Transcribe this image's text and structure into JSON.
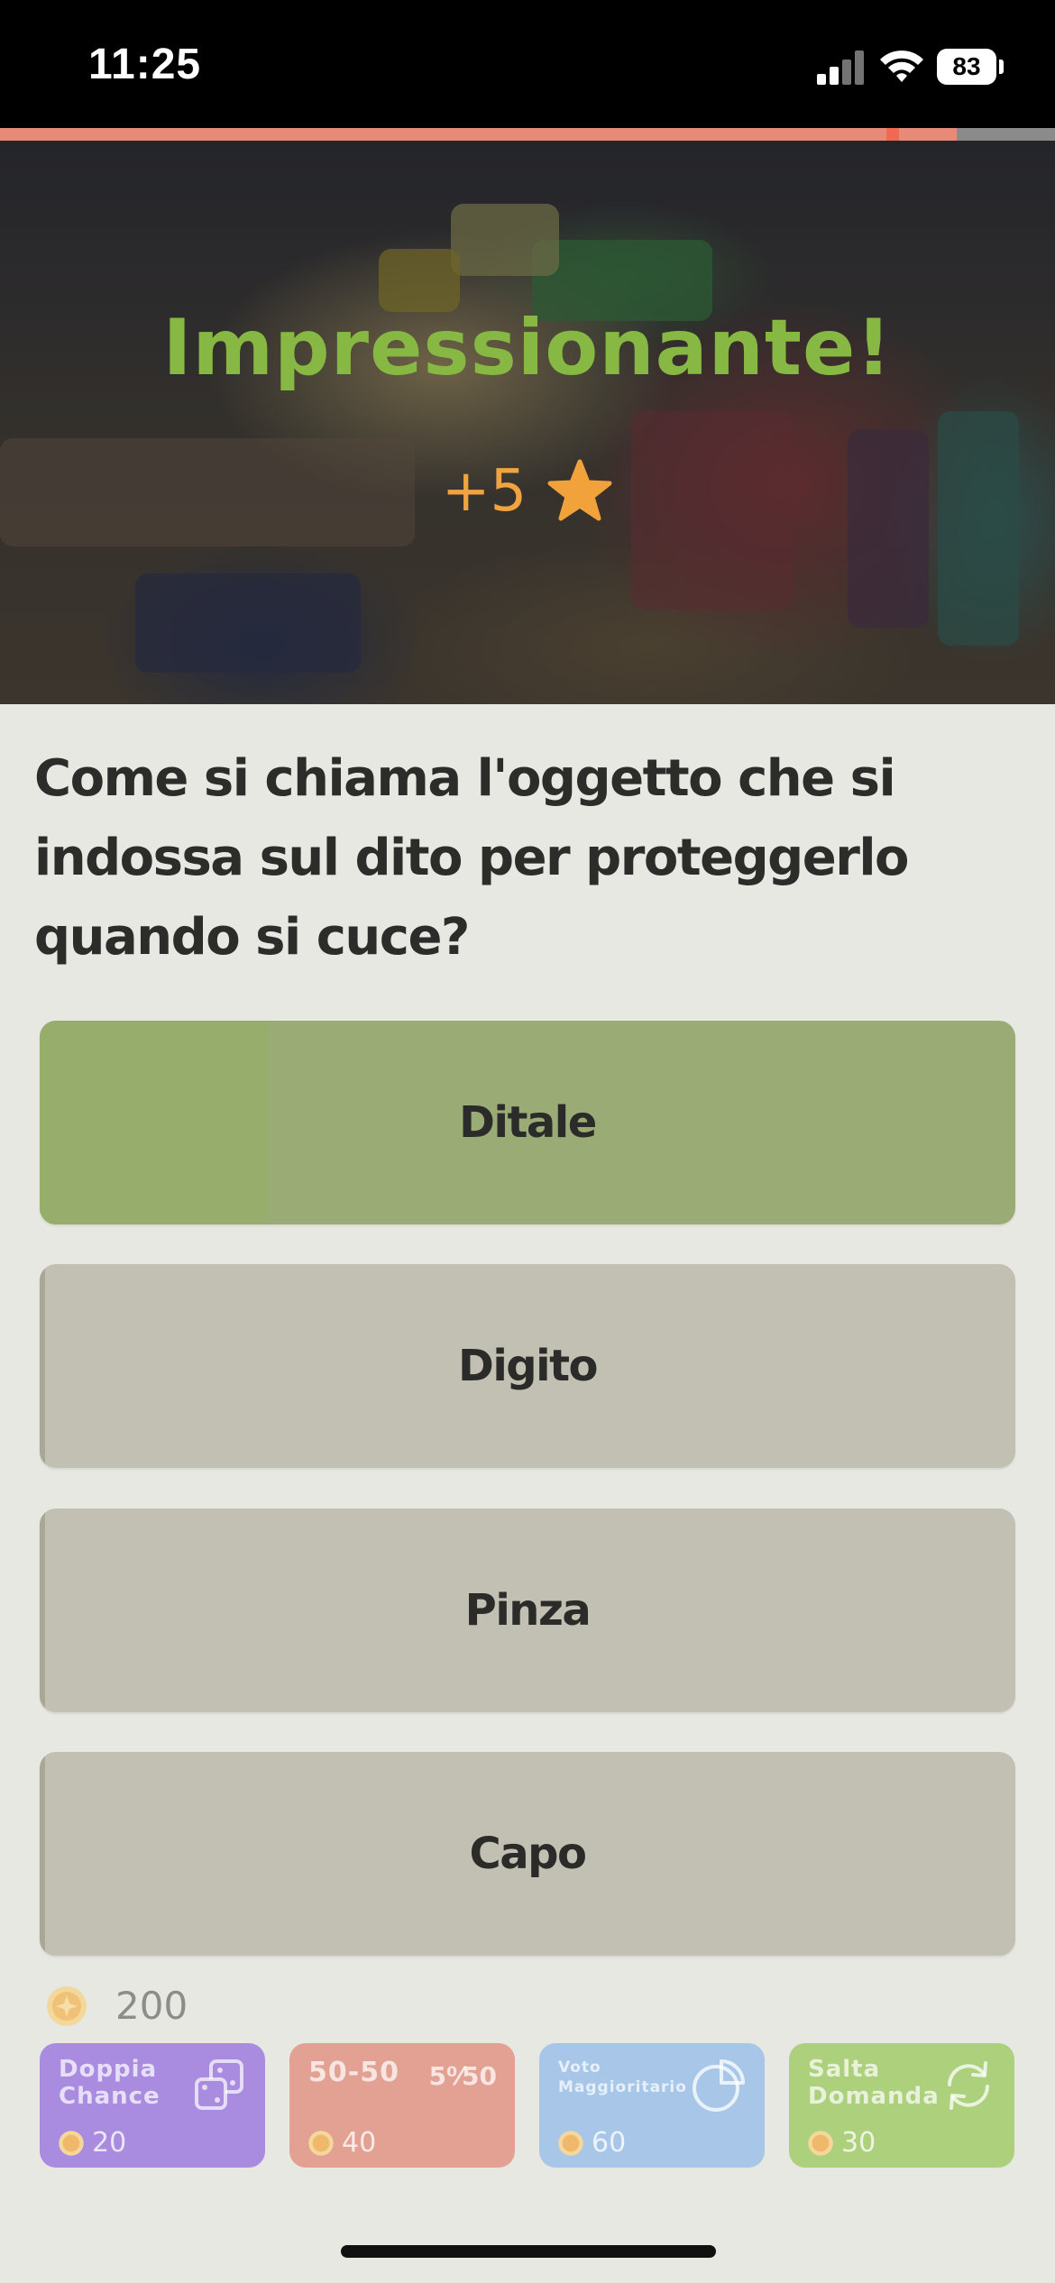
{
  "status_bar": {
    "time": "11:25",
    "battery": "83"
  },
  "progress": {
    "fraction": 0.907,
    "marker_fraction": 0.84
  },
  "hero": {
    "title": "Impressionante!",
    "points": "+5",
    "icon": "star-icon"
  },
  "question": {
    "text": "Come si chiama l'oggetto che si indossa sul dito per proteggerlo quando si cuce?"
  },
  "answers": [
    {
      "label": "Ditale",
      "state": "correct"
    },
    {
      "label": "Digito",
      "state": "disabled"
    },
    {
      "label": "Pinza",
      "state": "disabled"
    },
    {
      "label": "Capo",
      "state": "disabled"
    }
  ],
  "coins": {
    "balance": "200",
    "icon": "coin-icon"
  },
  "powerups": [
    {
      "label": "Doppia Chance",
      "cost": "20",
      "icon": "dice-icon",
      "color": "#a98be0"
    },
    {
      "label": "50-50",
      "cost": "40",
      "icon": "fifty-fifty-icon",
      "glyph": "5⁰⁄50",
      "color": "#e3a193"
    },
    {
      "label": "Voto Maggioritario",
      "cost": "60",
      "icon": "pie-chart-icon",
      "color": "#a8c7e8"
    },
    {
      "label": "Salta Domanda",
      "cost": "30",
      "icon": "refresh-icon",
      "color": "#acd07c"
    }
  ],
  "colors": {
    "accent_green": "#87b843",
    "points_orange": "#f0a33e",
    "correct_answer": "#9bab76",
    "answer_neutral": "#c2c0b2",
    "progress": "#e88a78",
    "background": "#e7e8e2"
  }
}
